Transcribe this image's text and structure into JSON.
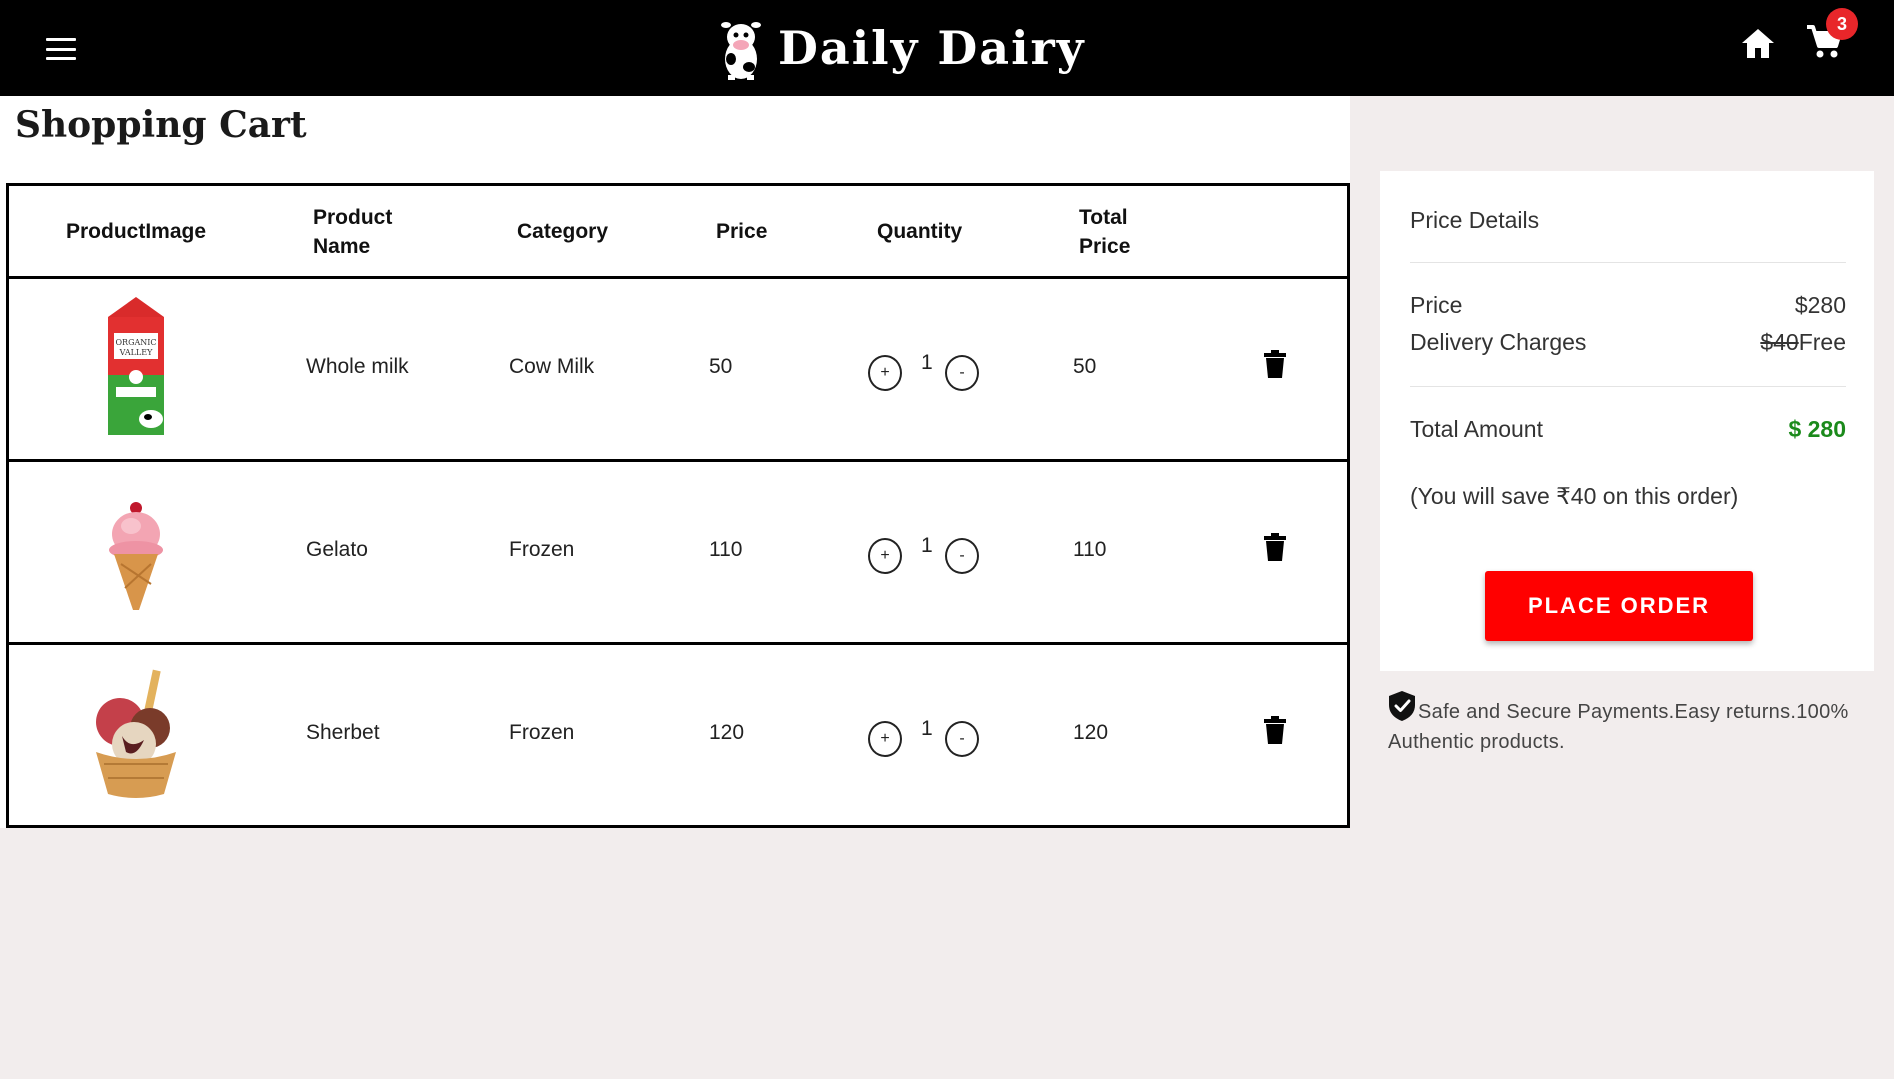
{
  "header": {
    "brand_name": "Daily Dairy",
    "cart_count": "3",
    "icons": [
      "menu-icon",
      "cow-logo",
      "home-icon",
      "cart-icon"
    ]
  },
  "page": {
    "title": "Shopping Cart"
  },
  "table": {
    "headers": {
      "image": "ProductImage",
      "name_line1": "Product",
      "name_line2": "Name",
      "category": "Category",
      "price": "Price",
      "quantity": "Quantity",
      "total_line1": "Total",
      "total_line2": "Price"
    },
    "rows": [
      {
        "image": "milk-carton-image",
        "name": "Whole milk",
        "category": "Cow Milk",
        "price": "50",
        "qty_plus": "+",
        "quantity": "1",
        "qty_minus": "-",
        "total": "50"
      },
      {
        "image": "gelato-cone-image",
        "name": "Gelato",
        "category": "Frozen",
        "price": "110",
        "qty_plus": "+",
        "quantity": "1",
        "qty_minus": "-",
        "total": "110"
      },
      {
        "image": "sherbet-cup-image",
        "name": "Sherbet",
        "category": "Frozen",
        "price": "120",
        "qty_plus": "+",
        "quantity": "1",
        "qty_minus": "-",
        "total": "120"
      }
    ]
  },
  "price_details": {
    "title": "Price Details",
    "price_label": "Price",
    "price_value": "$280",
    "delivery_label": "Delivery Charges",
    "delivery_original": "$40",
    "delivery_value": "Free",
    "total_label": "Total Amount",
    "total_value": "$ 280",
    "save_note": "(You will save ₹40 on this order)",
    "place_order": "PLACE ORDER"
  },
  "secure_note": "Safe and Secure Payments.Easy returns.100% Authentic products.",
  "colors": {
    "header_bg": "#000000",
    "accent_red": "#ff0000",
    "badge_red": "#e8262a",
    "total_green": "#1b8a1b",
    "page_bg": "#f2eded"
  }
}
